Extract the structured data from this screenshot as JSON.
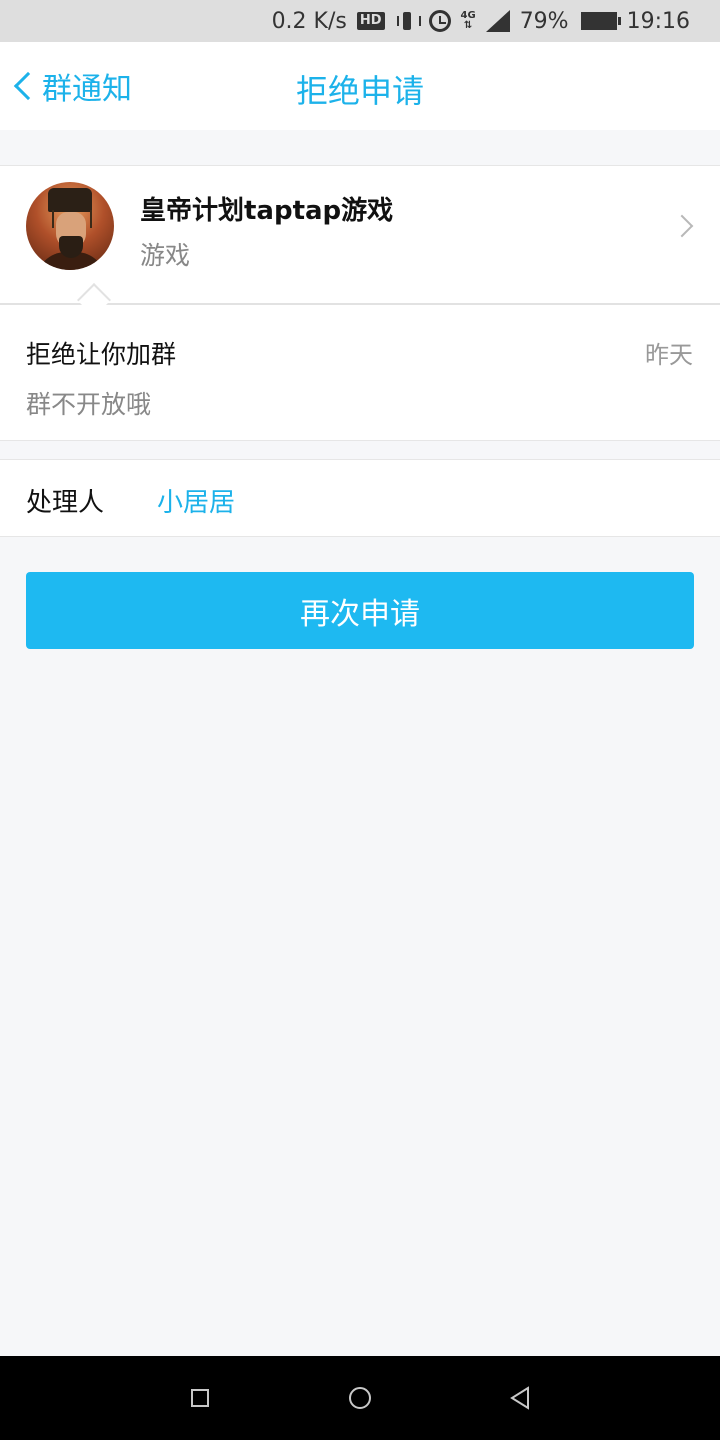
{
  "status_bar": {
    "speed": "0.2 K/s",
    "hd": "HD",
    "network": "4G",
    "battery": "79%",
    "time": "19:16"
  },
  "header": {
    "back_label": "群通知",
    "title": "拒绝申请"
  },
  "group": {
    "name": "皇帝计划taptap游戏",
    "type": "游戏"
  },
  "message": {
    "title": "拒绝让你加群",
    "time": "昨天",
    "body": "群不开放哦"
  },
  "handler": {
    "label": "处理人",
    "name": "小居居"
  },
  "actions": {
    "reapply_label": "再次申请"
  },
  "colors": {
    "accent": "#1cb2ea",
    "button": "#1eb9f1",
    "background": "#f6f7f9"
  }
}
